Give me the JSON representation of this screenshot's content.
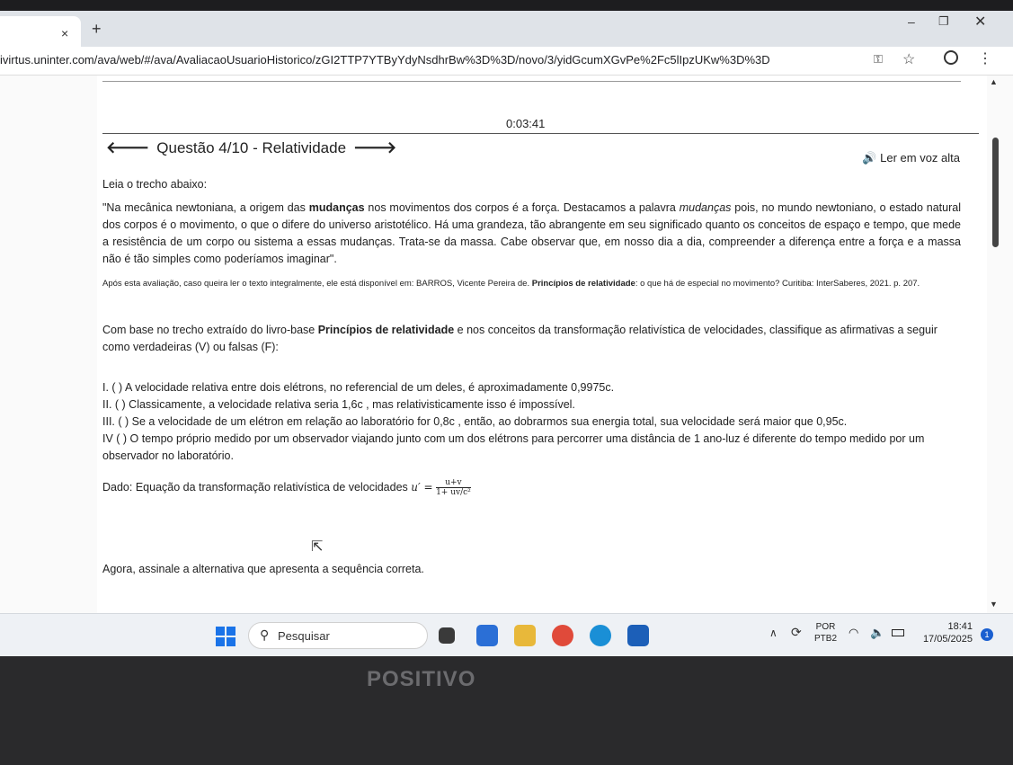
{
  "browser": {
    "tab_close": "×",
    "new_tab": "+",
    "min": "–",
    "max": "❐",
    "close": "✕",
    "url": "ivirtus.uninter.com/ava/web/#/ava/AvaliacaoUsuarioHistorico/zGI2TTP7YTByYdyNsdhrBw%3D%3D/novo/3/yidGcumXGvPe%2Fc5lIpzUKw%3D%3D",
    "menu": "⋮"
  },
  "page": {
    "timer": "0:03:41",
    "question_title": "Questão 4/10 - Relatividade",
    "prev_arrow": "🡐",
    "next_arrow": "🡒",
    "read_aloud": "🔊 Ler em voz alta",
    "intro": "Leia o trecho abaixo:",
    "quote_start": "\"Na mecânica newtoniana, a origem das ",
    "quote_bold": "mudanças",
    "quote_mid": " nos movimentos dos corpos é a força. Destacamos a palavra ",
    "quote_italic": "mudanças",
    "quote_end": " pois, no mundo newtoniano, o estado natural dos corpos é o movimento, o que o difere do universo aristotélico. Há uma grandeza, tão abrangente em seu significado quanto os conceitos de espaço e tempo, que mede a resistência de um corpo ou sistema a essas mudanças. Trata-se da massa. Cabe observar que, em nosso dia a dia, compreender a diferença entre a força e a massa não é tão simples como poderíamos imaginar\".",
    "source_start": "Após esta avaliação, caso queira ler o texto integralmente, ele está disponível em: BARROS, Vicente Pereira de. ",
    "source_bold": "Princípios de relatividade",
    "source_end": ": o que há de especial no movimento? Curitiba: InterSaberes, 2021. p. 207.",
    "prompt_start": "Com base no trecho extraído do livro-base ",
    "prompt_bold": "Princípios de relatividade",
    "prompt_end": " e nos conceitos da transformação relativística de velocidades, classifique as afirmativas a seguir como verdadeiras (V) ou falsas (F):",
    "items": [
      "I. ( ) A velocidade relativa entre dois elétrons, no referencial de um deles, é aproximadamente 0,9975c.",
      "II. ( ) Classicamente, a velocidade relativa seria 1,6c , mas relativisticamente isso é impossível.",
      "III. ( ) Se a velocidade de um elétron em relação ao laboratório for  0,8c , então, ao dobrarmos sua energia total, sua velocidade será maior que  0,95c.",
      "IV  ( ) O tempo próprio medido por um observador viajando junto com um dos elétrons para percorrer uma distância de 1 ano-luz é diferente do tempo medido por um observador no laboratório."
    ],
    "given_label": "Dado: Equação da transformação relativística de velocidades ",
    "eq_lhs": "u′ =",
    "eq_num": "u+v",
    "eq_den": "1+ uv/c²",
    "final": "Agora, assinale a alternativa que apresenta a sequência correta."
  },
  "taskbar": {
    "search": "Pesquisar",
    "lang_top": "POR",
    "lang_bottom": "PTB2",
    "time": "18:41",
    "date": "17/05/2025",
    "notif_count": "1"
  },
  "bezel": {
    "brand": "POSITIVO"
  }
}
